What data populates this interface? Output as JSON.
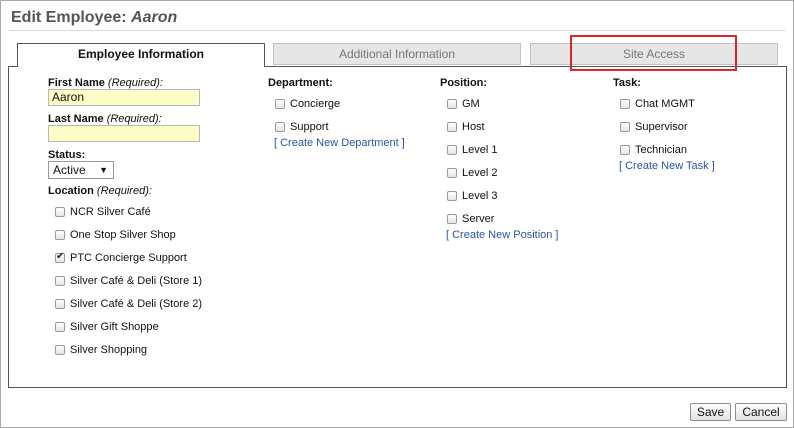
{
  "dialog": {
    "title_prefix": "Edit Employee:",
    "employee_name": "Aaron"
  },
  "tabs": [
    {
      "label": "Employee Information",
      "active": true
    },
    {
      "label": "Additional Information",
      "active": false
    },
    {
      "label": "Site Access",
      "active": false
    }
  ],
  "form": {
    "first_name": {
      "label": "First Name",
      "required": "(Required):",
      "value": "Aaron"
    },
    "last_name": {
      "label": "Last Name",
      "required": "(Required):",
      "value": ""
    },
    "status": {
      "label": "Status:",
      "value": "Active"
    },
    "location": {
      "label": "Location",
      "required": "(Required):",
      "items": [
        {
          "label": "NCR Silver Café",
          "checked": false
        },
        {
          "label": "One Stop Silver Shop",
          "checked": false
        },
        {
          "label": "PTC Concierge Support",
          "checked": true
        },
        {
          "label": "Silver Café & Deli (Store 1)",
          "checked": false
        },
        {
          "label": "Silver Café & Deli (Store 2)",
          "checked": false
        },
        {
          "label": "Silver Gift Shoppe",
          "checked": false
        },
        {
          "label": "Silver Shopping",
          "checked": false
        }
      ]
    }
  },
  "department": {
    "label": "Department:",
    "items": [
      {
        "label": "Concierge",
        "checked": false
      },
      {
        "label": "Support",
        "checked": false
      }
    ],
    "create_link": "[ Create New Department ]"
  },
  "position": {
    "label": "Position:",
    "items": [
      {
        "label": "GM",
        "checked": false
      },
      {
        "label": "Host",
        "checked": false
      },
      {
        "label": "Level 1",
        "checked": false
      },
      {
        "label": "Level 2",
        "checked": false
      },
      {
        "label": "Level 3",
        "checked": false
      },
      {
        "label": "Server",
        "checked": false
      }
    ],
    "create_link": "[ Create New Position ]"
  },
  "task": {
    "label": "Task:",
    "items": [
      {
        "label": "Chat MGMT",
        "checked": false
      },
      {
        "label": "Supervisor",
        "checked": false
      },
      {
        "label": "Technician",
        "checked": false
      }
    ],
    "create_link": "[ Create New Task ]"
  },
  "buttons": {
    "save": "Save",
    "cancel": "Cancel"
  },
  "colors": {
    "highlight": "#d9272e",
    "link": "#2a55a5",
    "input_bg": "#fdfdc8"
  }
}
